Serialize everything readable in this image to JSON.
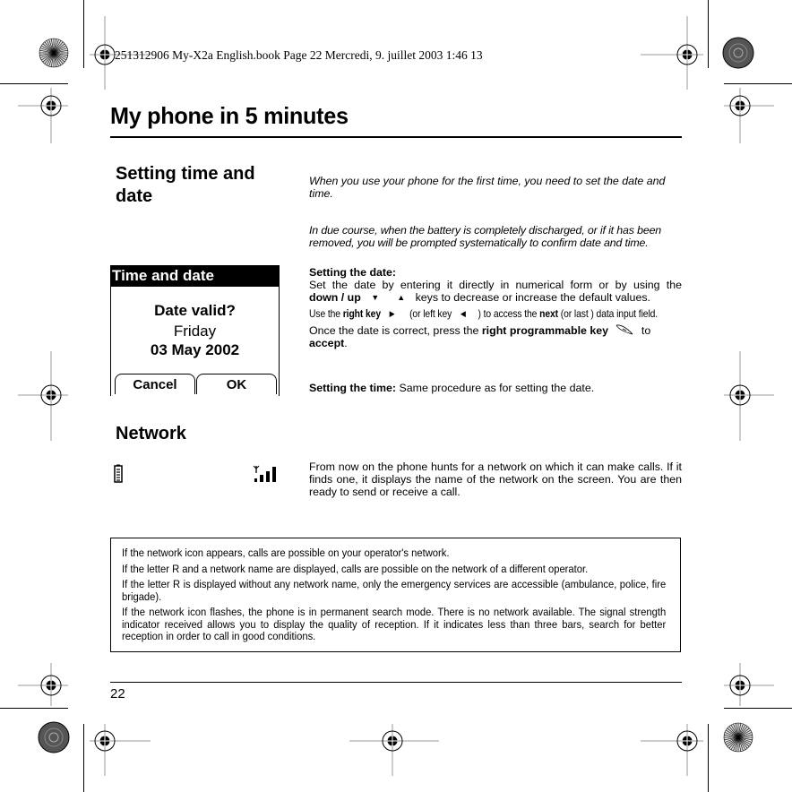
{
  "header": {
    "book_meta": "251312906 My-X2a English.book  Page 22  Mercredi, 9. juillet 2003  1:46 13"
  },
  "page": {
    "title": "My phone in 5 minutes",
    "page_number": "22"
  },
  "section_time_date": {
    "heading": "Setting time and date",
    "intro_1": "When you use your phone for the first time, you need to set the date and time.",
    "intro_2": "In due course, when the battery is completely discharged, or if it has been removed, you will be prompted systematically to confirm date and time.",
    "setting_date_label": "Setting the date:",
    "setting_date_text_1": "Set the date by entering it directly in numerical form or by using the",
    "down_up_label": "down / up",
    "down_up_suffix": "keys to decrease or increase the default values.",
    "use_the": "Use the",
    "right_key": "right key",
    "or_left_key": "(or left key",
    "to_access": ") to access the",
    "next": "next",
    "or_last": "(or last ) data input field.",
    "once_prefix": "Once the date is correct, press the",
    "right_prog_key": "right programmable key",
    "to": "to",
    "accept": "accept",
    "period": ".",
    "setting_time_label": "Setting the time:",
    "setting_time_text": "Same procedure as for setting the date."
  },
  "phone_screen": {
    "title": "Time and date",
    "question": "Date valid?",
    "day": "Friday",
    "date": "03 May 2002",
    "left_softkey": "Cancel",
    "right_softkey": "OK"
  },
  "section_network": {
    "heading": "Network",
    "text": "From now on the phone hunts for a network on which it can make calls. If it finds one, it displays the name of the network on the screen. You are then ready to send or receive a call."
  },
  "note_box": {
    "lines": [
      "If the network icon appears, calls are possible on your operator's network.",
      "If the letter R and a network name are displayed, calls are possible on the network of a different operator.",
      "If the letter R is displayed without any network name, only the emergency services are accessible (ambulance, police, fire brigade).",
      "If the network icon flashes, the phone is in permanent search mode. There is no network available. The signal strength indicator received allows you to display the quality of reception. If it indicates less than three bars, search for better reception in order to call in good conditions."
    ]
  },
  "icons": {
    "down_arrow": "▼",
    "up_arrow": "▲",
    "right_arrow": "▶",
    "left_arrow": "◀"
  }
}
